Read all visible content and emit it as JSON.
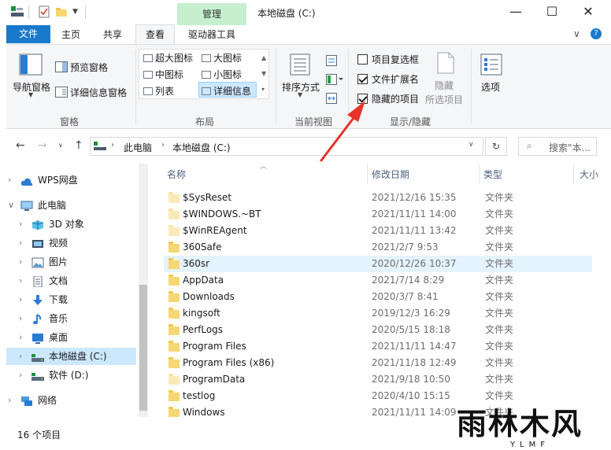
{
  "window": {
    "title": "本地磁盘 (C:)",
    "context_tab": "管理",
    "minimize": "—",
    "maximize": "☐",
    "close": "✕"
  },
  "tabs": {
    "file": "文件",
    "home": "主页",
    "share": "共享",
    "view": "查看",
    "drive_tools": "驱动器工具"
  },
  "ribbon": {
    "panes": {
      "nav_pane": "导航窗格",
      "preview_pane": "预览窗格",
      "details_pane": "详细信息窗格",
      "label": "窗格"
    },
    "layout": {
      "xlarge_icons": "超大图标",
      "large_icons": "大图标",
      "medium_icons": "中图标",
      "small_icons": "小图标",
      "list": "列表",
      "details": "详细信息",
      "label": "布局"
    },
    "current_view": {
      "sort_by": "排序方式",
      "label": "当前视图"
    },
    "show_hide": {
      "item_checkboxes": "项目复选框",
      "item_checkboxes_checked": false,
      "file_extensions": "文件扩展名",
      "file_extensions_checked": true,
      "hidden_items": "隐藏的项目",
      "hidden_items_checked": true,
      "hide_selected_line1": "隐藏",
      "hide_selected_line2": "所选项目",
      "label": "显示/隐藏"
    },
    "options": "选项"
  },
  "address": {
    "this_pc": "此电脑",
    "drive": "本地磁盘 (C:)",
    "search_placeholder": "搜索\"本..."
  },
  "nav": {
    "items": [
      {
        "label": "WPS网盘",
        "icon": "cloud-icon",
        "expandable": true,
        "indent": 0
      },
      {
        "label": "此电脑",
        "icon": "computer-icon",
        "expandable": true,
        "expanded": true,
        "indent": 0
      },
      {
        "label": "3D 对象",
        "icon": "cube-icon",
        "expandable": true,
        "indent": 1
      },
      {
        "label": "视频",
        "icon": "video-icon",
        "expandable": true,
        "indent": 1
      },
      {
        "label": "图片",
        "icon": "picture-icon",
        "expandable": true,
        "indent": 1
      },
      {
        "label": "文档",
        "icon": "document-icon",
        "expandable": true,
        "indent": 1
      },
      {
        "label": "下载",
        "icon": "download-icon",
        "expandable": true,
        "indent": 1
      },
      {
        "label": "音乐",
        "icon": "music-icon",
        "expandable": true,
        "indent": 1
      },
      {
        "label": "桌面",
        "icon": "desktop-icon",
        "expandable": true,
        "indent": 1
      },
      {
        "label": "本地磁盘 (C:)",
        "icon": "drive-icon",
        "expandable": true,
        "indent": 1,
        "selected": true
      },
      {
        "label": "软件 (D:)",
        "icon": "drive-icon",
        "expandable": true,
        "indent": 1
      },
      {
        "label": "网络",
        "icon": "network-icon",
        "expandable": true,
        "indent": 0
      }
    ]
  },
  "columns": {
    "name": "名称",
    "date": "修改日期",
    "type": "类型",
    "size": "大小"
  },
  "files": [
    {
      "name": "$SysReset",
      "date": "2021/12/16 15:35",
      "type": "文件夹",
      "hidden": true
    },
    {
      "name": "$WINDOWS.~BT",
      "date": "2021/11/11 14:00",
      "type": "文件夹",
      "hidden": true
    },
    {
      "name": "$WinREAgent",
      "date": "2021/11/11 13:42",
      "type": "文件夹",
      "hidden": true
    },
    {
      "name": "360Safe",
      "date": "2021/2/7 9:53",
      "type": "文件夹",
      "hidden": false
    },
    {
      "name": "360sr",
      "date": "2020/12/26 10:37",
      "type": "文件夹",
      "hidden": false,
      "selected": true
    },
    {
      "name": "AppData",
      "date": "2021/7/14 8:29",
      "type": "文件夹",
      "hidden": false
    },
    {
      "name": "Downloads",
      "date": "2020/3/7 8:41",
      "type": "文件夹",
      "hidden": false
    },
    {
      "name": "kingsoft",
      "date": "2019/12/3 16:29",
      "type": "文件夹",
      "hidden": false
    },
    {
      "name": "PerfLogs",
      "date": "2020/5/15 18:18",
      "type": "文件夹",
      "hidden": false
    },
    {
      "name": "Program Files",
      "date": "2021/11/11 14:47",
      "type": "文件夹",
      "hidden": false
    },
    {
      "name": "Program Files (x86)",
      "date": "2021/11/18 12:49",
      "type": "文件夹",
      "hidden": false
    },
    {
      "name": "ProgramData",
      "date": "2021/9/18 10:50",
      "type": "文件夹",
      "hidden": true
    },
    {
      "name": "testlog",
      "date": "2020/4/10 15:15",
      "type": "文件夹",
      "hidden": false
    },
    {
      "name": "Windows",
      "date": "2021/11/11 14:09",
      "type": "文件夹",
      "hidden": false
    }
  ],
  "status": {
    "count": "16 个项目"
  },
  "watermark": {
    "main": "雨林木风",
    "sub": "YLMF"
  },
  "colors": {
    "file_tab": "#1979ca",
    "context_tab": "#c6efce",
    "selection": "#cce8ff",
    "arrow": "#e8322a",
    "folder": "#f7d774"
  }
}
